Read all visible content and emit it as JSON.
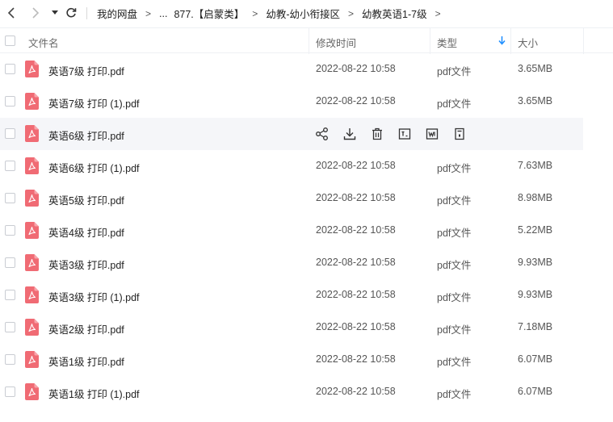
{
  "breadcrumb": {
    "items": [
      "我的网盘",
      "...",
      "877.【启蒙类】",
      "幼教-幼小衔接区",
      "幼教英语1-7级"
    ],
    "separator": ">"
  },
  "columns": {
    "name": "文件名",
    "modified": "修改时间",
    "type": "类型",
    "size": "大小"
  },
  "accent_color": "#1a8cff",
  "pdf_icon_color": "#f06b74",
  "files": [
    {
      "name": "英语7级 打印.pdf",
      "modified": "2022-08-22 10:58",
      "type": "pdf文件",
      "size": "3.65MB"
    },
    {
      "name": "英语7级 打印 (1).pdf",
      "modified": "2022-08-22 10:58",
      "type": "pdf文件",
      "size": "3.65MB"
    },
    {
      "name": "英语6级 打印.pdf",
      "modified": "",
      "type": "",
      "size": "",
      "hovered": true
    },
    {
      "name": "英语6级 打印 (1).pdf",
      "modified": "2022-08-22 10:58",
      "type": "pdf文件",
      "size": "7.63MB"
    },
    {
      "name": "英语5级 打印.pdf",
      "modified": "2022-08-22 10:58",
      "type": "pdf文件",
      "size": "8.98MB"
    },
    {
      "name": "英语4级 打印.pdf",
      "modified": "2022-08-22 10:58",
      "type": "pdf文件",
      "size": "5.22MB"
    },
    {
      "name": "英语3级 打印.pdf",
      "modified": "2022-08-22 10:58",
      "type": "pdf文件",
      "size": "9.93MB"
    },
    {
      "name": "英语3级 打印 (1).pdf",
      "modified": "2022-08-22 10:58",
      "type": "pdf文件",
      "size": "9.93MB"
    },
    {
      "name": "英语2级 打印.pdf",
      "modified": "2022-08-22 10:58",
      "type": "pdf文件",
      "size": "7.18MB"
    },
    {
      "name": "英语1级 打印.pdf",
      "modified": "2022-08-22 10:58",
      "type": "pdf文件",
      "size": "6.07MB"
    },
    {
      "name": "英语1级 打印 (1).pdf",
      "modified": "2022-08-22 10:58",
      "type": "pdf文件",
      "size": "6.07MB"
    }
  ],
  "hover_actions": [
    "share-icon",
    "download-icon",
    "delete-icon",
    "text-extract-icon",
    "word-convert-icon",
    "more-icon"
  ]
}
